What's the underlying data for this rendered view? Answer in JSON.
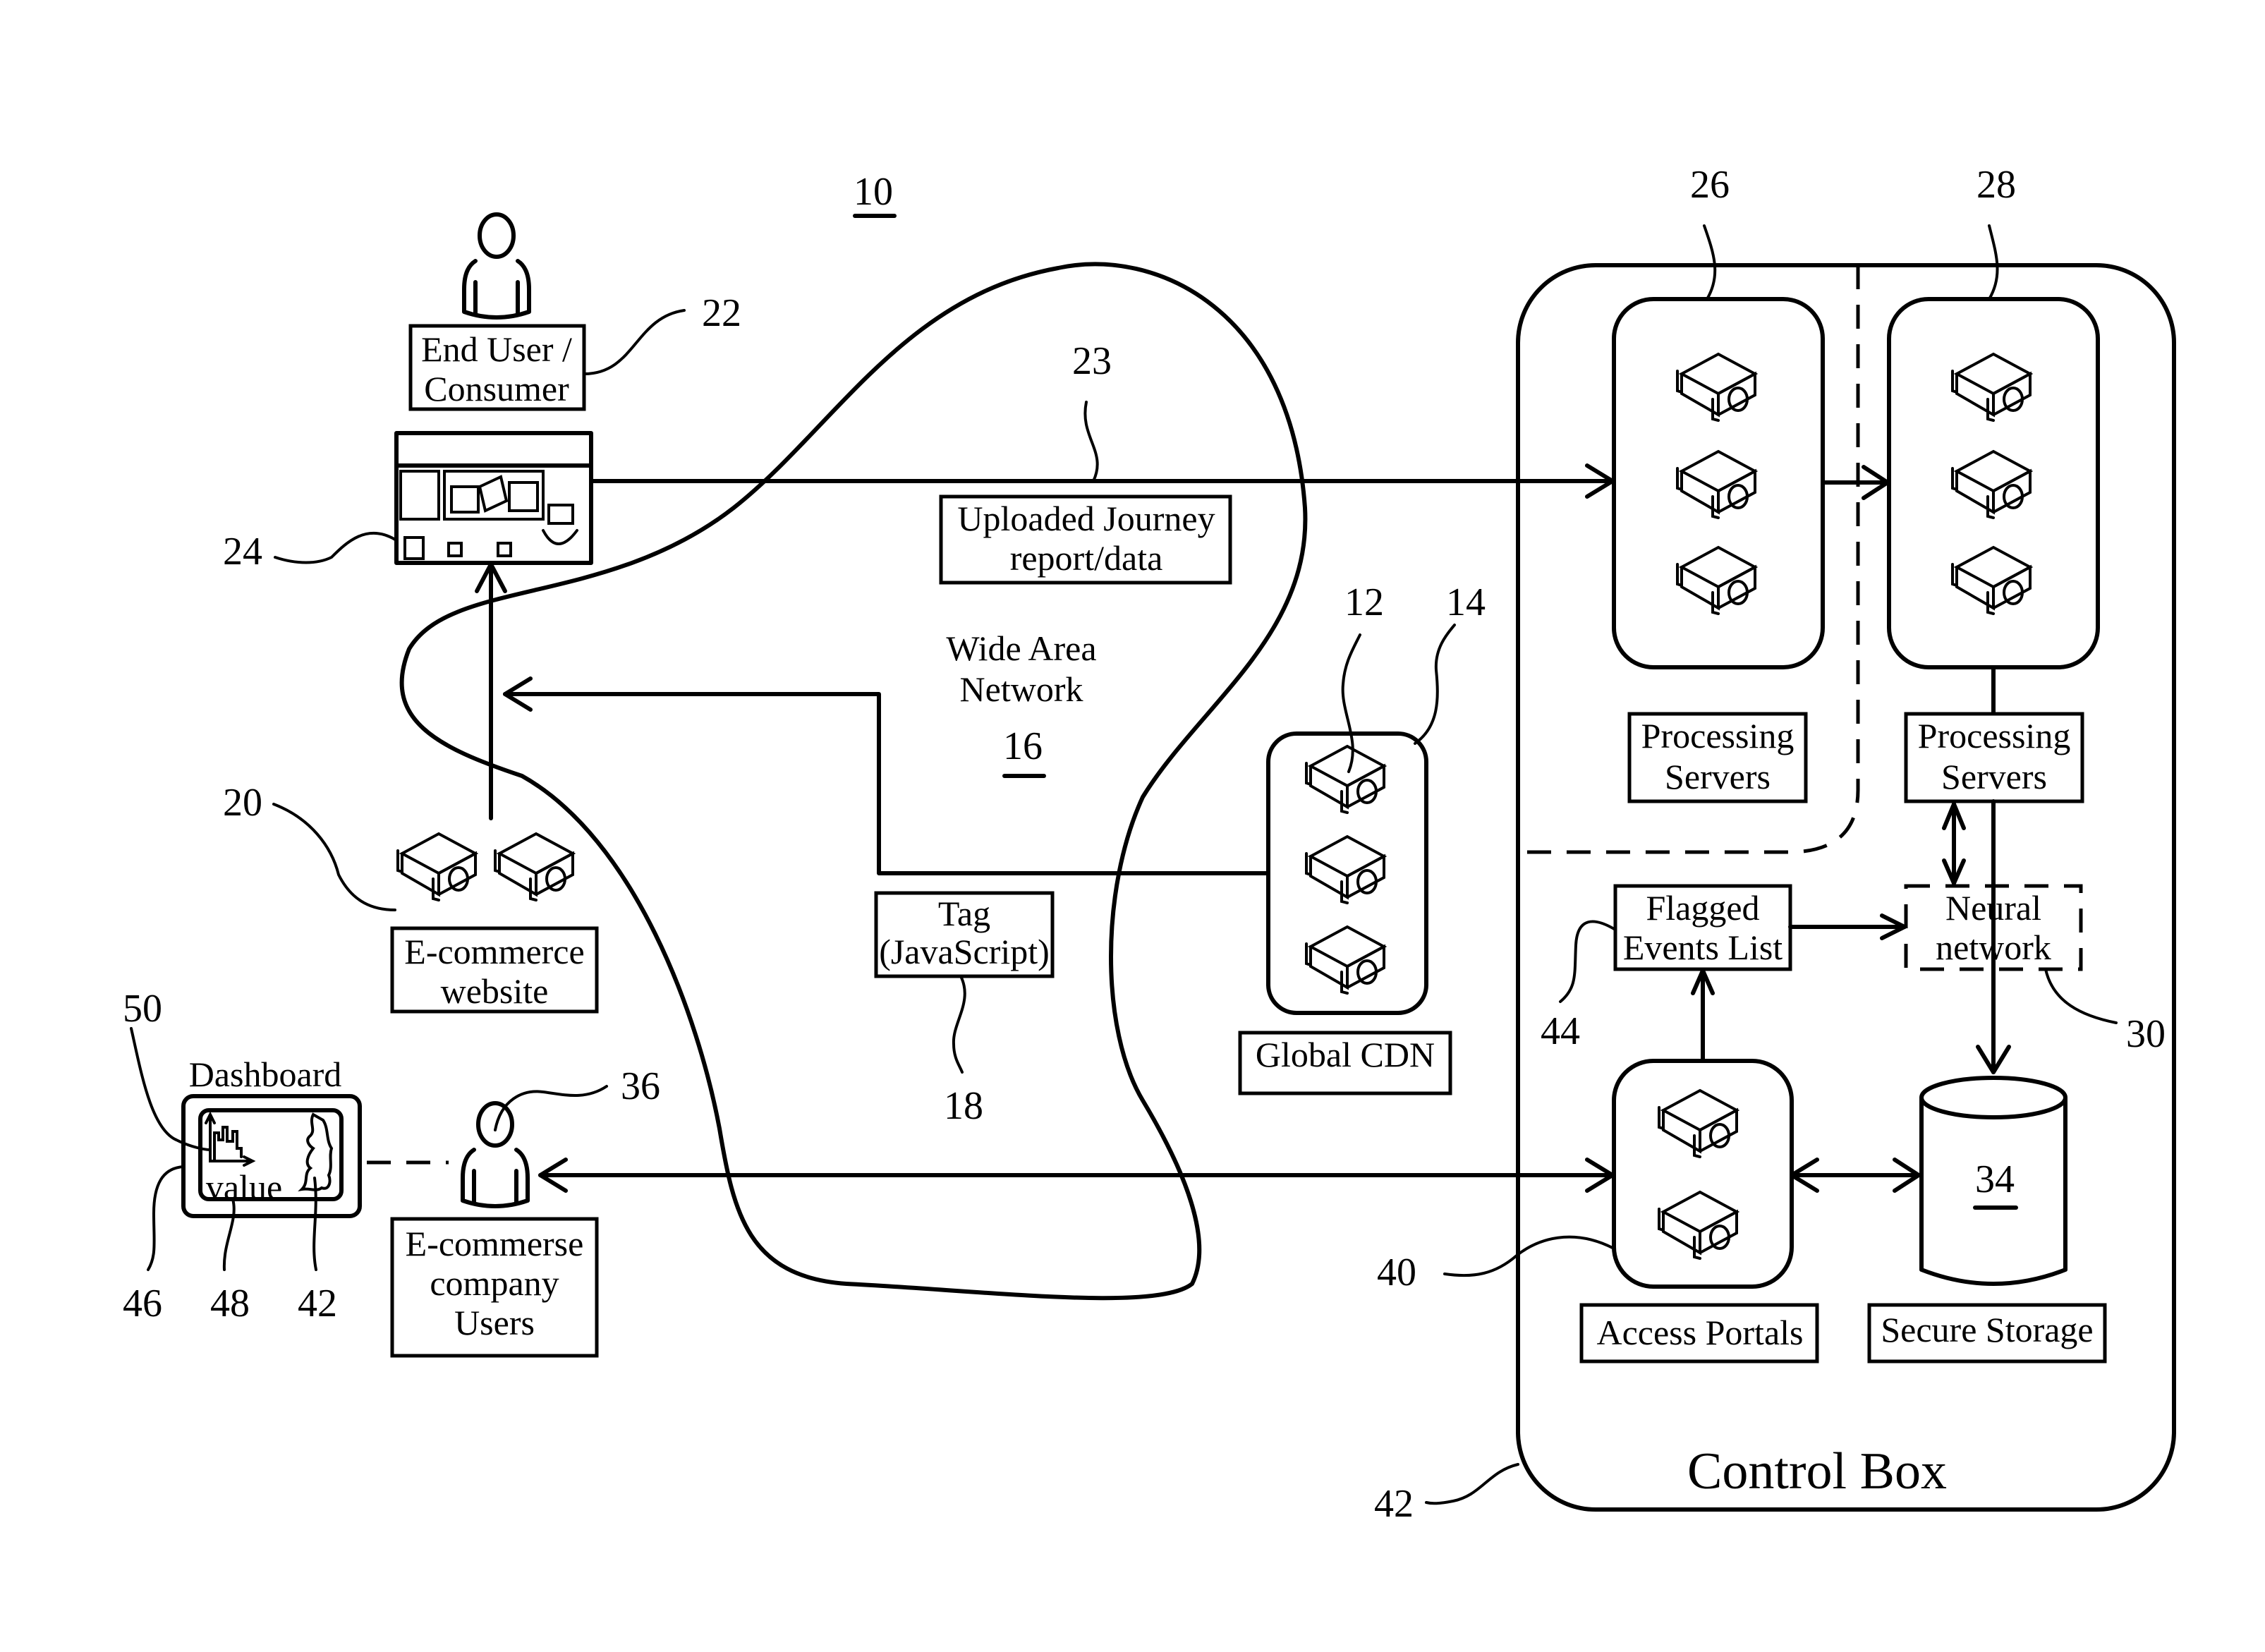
{
  "figure": {
    "system_ref": "10",
    "wan": {
      "line1": "Wide Area",
      "line2": "Network",
      "ref": "16"
    },
    "end_user": {
      "line1": "End User /",
      "line2": "Consumer",
      "ref": "22"
    },
    "browser_ref": "24",
    "upload": {
      "line1": "Uploaded Journey",
      "line2": "report/data",
      "ref": "23"
    },
    "ecommerce_site": {
      "line1": "E-commerce",
      "line2": "website",
      "ref": "20"
    },
    "tag": {
      "line1": "Tag",
      "line2": "(JavaScript)",
      "ref": "18"
    },
    "cdn": {
      "label": "Global CDN",
      "ref_server": "12",
      "ref_box": "14"
    },
    "processing_1": {
      "line1": "Processing",
      "line2": "Servers",
      "ref": "26"
    },
    "processing_2": {
      "line1": "Processing",
      "line2": "Servers",
      "ref": "28"
    },
    "flagged": {
      "line1": "Flagged",
      "line2": "Events List",
      "ref": "44"
    },
    "neural": {
      "line1": "Neural",
      "line2": "network",
      "ref": "30"
    },
    "storage": {
      "label": "Secure Storage",
      "ref": "34"
    },
    "portals": {
      "label": "Access Portals",
      "ref": "40"
    },
    "control_box": {
      "label": "Control Box",
      "ref": "42"
    },
    "company_users": {
      "line1": "E-commerse",
      "line2": "company",
      "line3": "Users",
      "ref": "36"
    },
    "dashboard": {
      "label": "Dashboard",
      "value_text": "value",
      "ref_chart": "50",
      "ref_screen": "46",
      "ref_value": "48",
      "ref_map": "42"
    }
  }
}
